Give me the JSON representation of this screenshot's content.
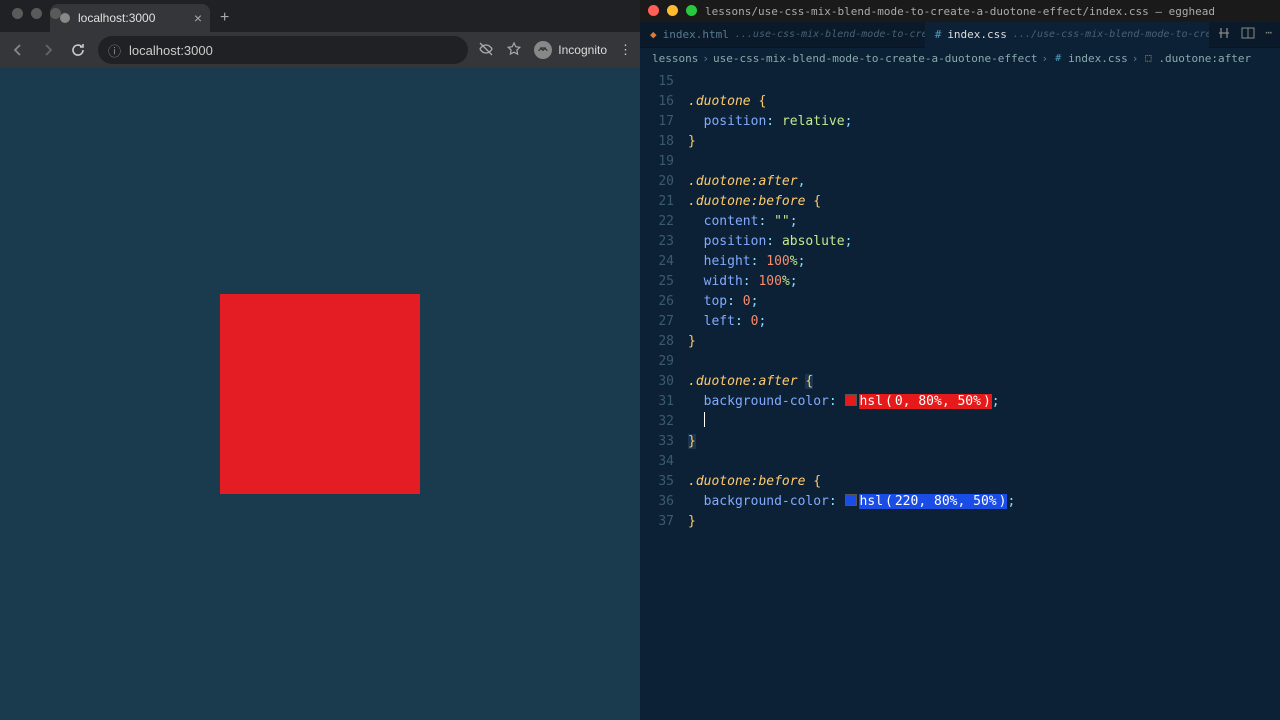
{
  "browser": {
    "tab": {
      "title": "localhost:3000"
    },
    "url": "localhost:3000",
    "incognito_label": "Incognito",
    "square_color": "#e41c23"
  },
  "editor": {
    "window_title": "lessons/use-css-mix-blend-mode-to-create-a-duotone-effect/index.css — egghead",
    "tabs": [
      {
        "name": "index.html",
        "path": "...use-css-mix-blend-mode-to-create-a-duotone-effect",
        "active": false
      },
      {
        "name": "index.css",
        "path": ".../use-css-mix-blend-mode-to-create-a-duotone-effect",
        "active": true,
        "modified": true
      }
    ],
    "breadcrumb": {
      "parts": [
        "lessons",
        "use-css-mix-blend-mode-to-create-a-duotone-effect",
        "index.css",
        ".duotone:after"
      ]
    },
    "line_start": 15,
    "code": [
      {
        "n": 15,
        "t": "blank"
      },
      {
        "n": 16,
        "sel": ".duotone",
        "open": true
      },
      {
        "n": 17,
        "prop": "position",
        "valkw": "relative"
      },
      {
        "n": 18,
        "close": true
      },
      {
        "n": 19,
        "t": "blank"
      },
      {
        "n": 20,
        "sel": ".duotone:after",
        "comma": true
      },
      {
        "n": 21,
        "sel": ".duotone:before",
        "open": true
      },
      {
        "n": 22,
        "prop": "content",
        "str": "\"\""
      },
      {
        "n": 23,
        "prop": "position",
        "valkw": "absolute"
      },
      {
        "n": 24,
        "prop": "height",
        "num": "100",
        "unit": "%"
      },
      {
        "n": 25,
        "prop": "width",
        "num": "100",
        "unit": "%"
      },
      {
        "n": 26,
        "prop": "top",
        "num": "0"
      },
      {
        "n": 27,
        "prop": "left",
        "num": "0"
      },
      {
        "n": 28,
        "close": true
      },
      {
        "n": 29,
        "t": "blank"
      },
      {
        "n": 30,
        "sel": ".duotone:after",
        "open": true,
        "open_hl": true
      },
      {
        "n": 31,
        "prop": "background-color",
        "colorfn": "hsl",
        "args": [
          "0",
          "80%",
          "50%"
        ],
        "swatch": "red"
      },
      {
        "n": 32,
        "cursor": true
      },
      {
        "n": 33,
        "close": true,
        "close_hl": true
      },
      {
        "n": 34,
        "t": "blank"
      },
      {
        "n": 35,
        "sel": ".duotone:before",
        "open": true
      },
      {
        "n": 36,
        "prop": "background-color",
        "colorfn": "hsl",
        "args": [
          "220",
          "80%",
          "50%"
        ],
        "swatch": "blue"
      },
      {
        "n": 37,
        "close": true
      }
    ]
  }
}
